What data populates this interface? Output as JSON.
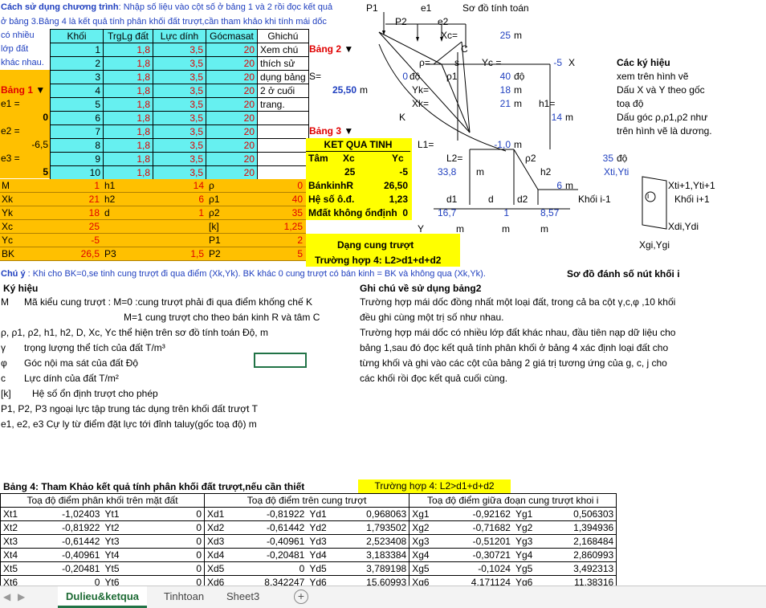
{
  "intro": {
    "line1_bold": "Cách sử dụng chương trình",
    "line1_rest": ": Nhập số liệu vào cột số ở bảng 1 và 2 rồi đọc kết quả",
    "line2": "ở bảng 3.Bảng 4 là kết quả tính phân khối đất trượt,cần tham khảo khi tính mái dốc",
    "left_notes": [
      "có nhiều",
      "lớp đất",
      "khác nhau."
    ]
  },
  "table1": {
    "headers": [
      "Khối",
      "TrgLg đất",
      "Lực dính",
      "Gócmasat",
      "Ghichú"
    ],
    "rows": [
      [
        "1",
        "1,8",
        "3,5",
        "20"
      ],
      [
        "2",
        "1,8",
        "3,5",
        "20"
      ],
      [
        "3",
        "1,8",
        "3,5",
        "20"
      ],
      [
        "4",
        "1,8",
        "3,5",
        "20"
      ],
      [
        "5",
        "1,8",
        "3,5",
        "20"
      ],
      [
        "6",
        "1,8",
        "3,5",
        "20"
      ],
      [
        "7",
        "1,8",
        "3,5",
        "20"
      ],
      [
        "8",
        "1,8",
        "3,5",
        "20"
      ],
      [
        "9",
        "1,8",
        "3,5",
        "20"
      ],
      [
        "10",
        "1,8",
        "3,5",
        "20"
      ]
    ],
    "notes": [
      "Xem chú",
      "thích sử",
      "dụng bảng",
      "2 ở cuối",
      "trang."
    ]
  },
  "bang1": {
    "title": "Bảng 1",
    "e1_label": "e1 =",
    "e1": "0",
    "e2_label": "e2 =",
    "e2": "-6,5",
    "e3_label": "e3 =",
    "e3": "5"
  },
  "params": [
    {
      "l1": "M",
      "v1": "1",
      "l2": "h1",
      "v2": "14",
      "l3": "ρ",
      "v3": "0"
    },
    {
      "l1": "Xk",
      "v1": "21",
      "l2": "h2",
      "v2": "6",
      "l3": "ρ1",
      "v3": "40"
    },
    {
      "l1": "Yk",
      "v1": "18",
      "l2": "d",
      "v2": "1",
      "l3": "ρ2",
      "v3": "35"
    },
    {
      "l1": "Xc",
      "v1": "25",
      "l2": "",
      "v2": "",
      "l3": "[k]",
      "v3": "1,25"
    },
    {
      "l1": "Yc",
      "v1": "-5",
      "l2": "",
      "v2": "",
      "l3": "P1",
      "v3": "2"
    },
    {
      "l1": "BK",
      "v1": "26,5",
      "l2": "P3",
      "v2": "1,5",
      "l3": "P2",
      "v3": "5"
    }
  ],
  "bang2": {
    "title": "Bảng 2",
    "s_label": "S=",
    "s_value": "25,50",
    "s_unit": "m"
  },
  "bang3": {
    "title": "Bảng 3",
    "header": "KET QUA TINH",
    "tam": "Tâm",
    "xc_h": "Xc",
    "yc_h": "Yc",
    "xc": "25",
    "yc": "-5",
    "bk_label": "BánkinhR",
    "bk": "26,50",
    "hs_label": "Hệ số ô.đ.",
    "hs": "1,23",
    "md_label": "Mđất không ổnđịnh",
    "md": "0",
    "dang": "Dạng cung trượt",
    "truonghop": "Trường hợp 4: L2>d1+d+d2"
  },
  "diagram": {
    "P1": "P1",
    "e1": "e1",
    "title": "Sơ đồ tính toán",
    "P2": "P2",
    "e2": "e2",
    "Xc_label": "Xc=",
    "Xc_val": "25",
    "Xc_unit": "m",
    "C": "C",
    "rho": "ρ=",
    "rho_val": "0",
    "rho_unit": "độ",
    "s": "s",
    "rho1": "ρ1",
    "Yc_label": "Yc =",
    "Yc_val": "-5",
    "X": "X",
    "rho1_val": "40",
    "rho1_unit": "độ",
    "Yk_label": "Yk=",
    "Yk_val": "18",
    "m": "m",
    "Xk_label": "Xk=",
    "Xk_val": "21",
    "h1_label": "h1=",
    "K": "K",
    "h1_val": "14",
    "L1": "L1=",
    "L1_val": "-1,0",
    "L2": "L2=",
    "L2_val": "33,8",
    "rho2": "ρ2",
    "rho2_val": "35",
    "do": "độ",
    "h2": "h2",
    "h2_val": "6",
    "d1": "d1",
    "d": "d",
    "d2": "d2",
    "d1_val": "16,7",
    "d_val": "1",
    "d2_val": "8,57",
    "Y": "Y",
    "xtiyti": "Xti,Yti"
  },
  "symbols": {
    "title": "Các ký hiệu",
    "lines": [
      "xem trên hình vẽ",
      "Dấu X và Y theo gốc",
      "toạ độ",
      "Dấu góc ρ,ρ1,ρ2 như",
      "trên hình vẽ là dương."
    ]
  },
  "block": {
    "xti1": "Xti+1,Yti+1",
    "khoi_prev": "Khối i-1",
    "i": "i",
    "khoi_next": "Khối i+1",
    "xdi": "Xdi,Ydi",
    "xgi": "Xgi,Ygi",
    "title": "Sơ đồ đánh số nút khối i"
  },
  "chuy": {
    "bold": "Chú ý",
    "rest": " : Khi cho BK=0,se tinh cung trượt đi qua điểm (Xk,Yk). BK khác 0 cung trượt có bán kinh = BK và không qua (Xk,Yk)."
  },
  "kyhieu": {
    "title": "Ký hiệu",
    "lines": [
      [
        "M",
        "Mã kiểu cung trượt : M=0 :cung trượt phải đi qua điểm khống chế K"
      ],
      [
        "",
        "M=1  cung trượt cho theo bán kinh R và tâm C"
      ],
      [
        "",
        "ρ, ρ1, ρ2, h1, h2, D, Xc, Yc thể hiện trên sơ đồ tính toán    Độ, m"
      ],
      [
        "γ",
        "trọng lượng thể tích của đất   T/m³"
      ],
      [
        "φ",
        "Góc nội ma sát của đất  Độ"
      ],
      [
        "c",
        "Lực dính của đất      T/m²"
      ],
      [
        "[k]",
        "Hệ số ổn định trượt cho phép"
      ],
      [
        "",
        "P1, P2, P3 ngoại lực tập trung tác dụng trên khối đất trượt    T"
      ],
      [
        "",
        "e1, e2, e3  Cự ly từ điểm đặt lực tới đỉnh taluy(gốc toạ độ)  m"
      ]
    ]
  },
  "ghichu": {
    "title": "Ghi chú về sử dụng bảng2",
    "lines": [
      "Trường hợp mái dốc đồng nhất một loại đất, trong cả ba cột γ,c,φ ,10 khối",
      "đều ghi cùng một trị số như nhau.",
      "Trường hợp mái dốc có nhiều lớp đất khác nhau, đầu tiên nạp dữ liệu cho",
      "bảng 1,sau đó đọc kết quả tính phân khối ở bảng 4 xác định loại đất cho",
      "từng khối và ghi vào các cột của bảng 2 giá trị tương ứng của g, c, j cho",
      "các khối rồi đọc kết quả cuối cùng."
    ]
  },
  "bang4": {
    "title": "Bảng 4: Tham Khảo kết quả tính phân khối đất trượt,nếu cần thiết",
    "case": "Trường hợp 4: L2>d1+d+d2",
    "h1": "Toạ độ điểm phân khối trên mặt đất",
    "h2": "Toạ độ điểm trên cung trượt",
    "h3": "Toạ độ điểm giữa đoạn cung trượt khoi i",
    "rows": [
      [
        "Xt1",
        "-1,02403",
        "Yt1",
        "0",
        "Xd1",
        "-0,81922",
        "Yd1",
        "0,968063",
        "Xg1",
        "-0,92162",
        "Yg1",
        "0,506303"
      ],
      [
        "Xt2",
        "-0,81922",
        "Yt2",
        "0",
        "Xd2",
        "-0,61442",
        "Yd2",
        "1,793502",
        "Xg2",
        "-0,71682",
        "Yg2",
        "1,394936"
      ],
      [
        "Xt3",
        "-0,61442",
        "Yt3",
        "0",
        "Xd3",
        "-0,40961",
        "Yd3",
        "2,523408",
        "Xg3",
        "-0,51201",
        "Yg3",
        "2,168484"
      ],
      [
        "Xt4",
        "-0,40961",
        "Yt4",
        "0",
        "Xd4",
        "-0,20481",
        "Yd4",
        "3,183384",
        "Xg4",
        "-0,30721",
        "Yg4",
        "2,860993"
      ],
      [
        "Xt5",
        "-0,20481",
        "Yt5",
        "0",
        "Xd5",
        "0",
        "Yd5",
        "3,789198",
        "Xg5",
        "-0,1024",
        "Yg5",
        "3,492313"
      ],
      [
        "Xt6",
        "0",
        "Yt6",
        "0",
        "Xd6",
        "8,342247",
        "Yd6",
        "15,60993",
        "Xg6",
        "4,171124",
        "Yg6",
        "11,38316"
      ]
    ]
  },
  "tabs": [
    "Dulieu&ketqua",
    "Tinhtoan",
    "Sheet3"
  ]
}
